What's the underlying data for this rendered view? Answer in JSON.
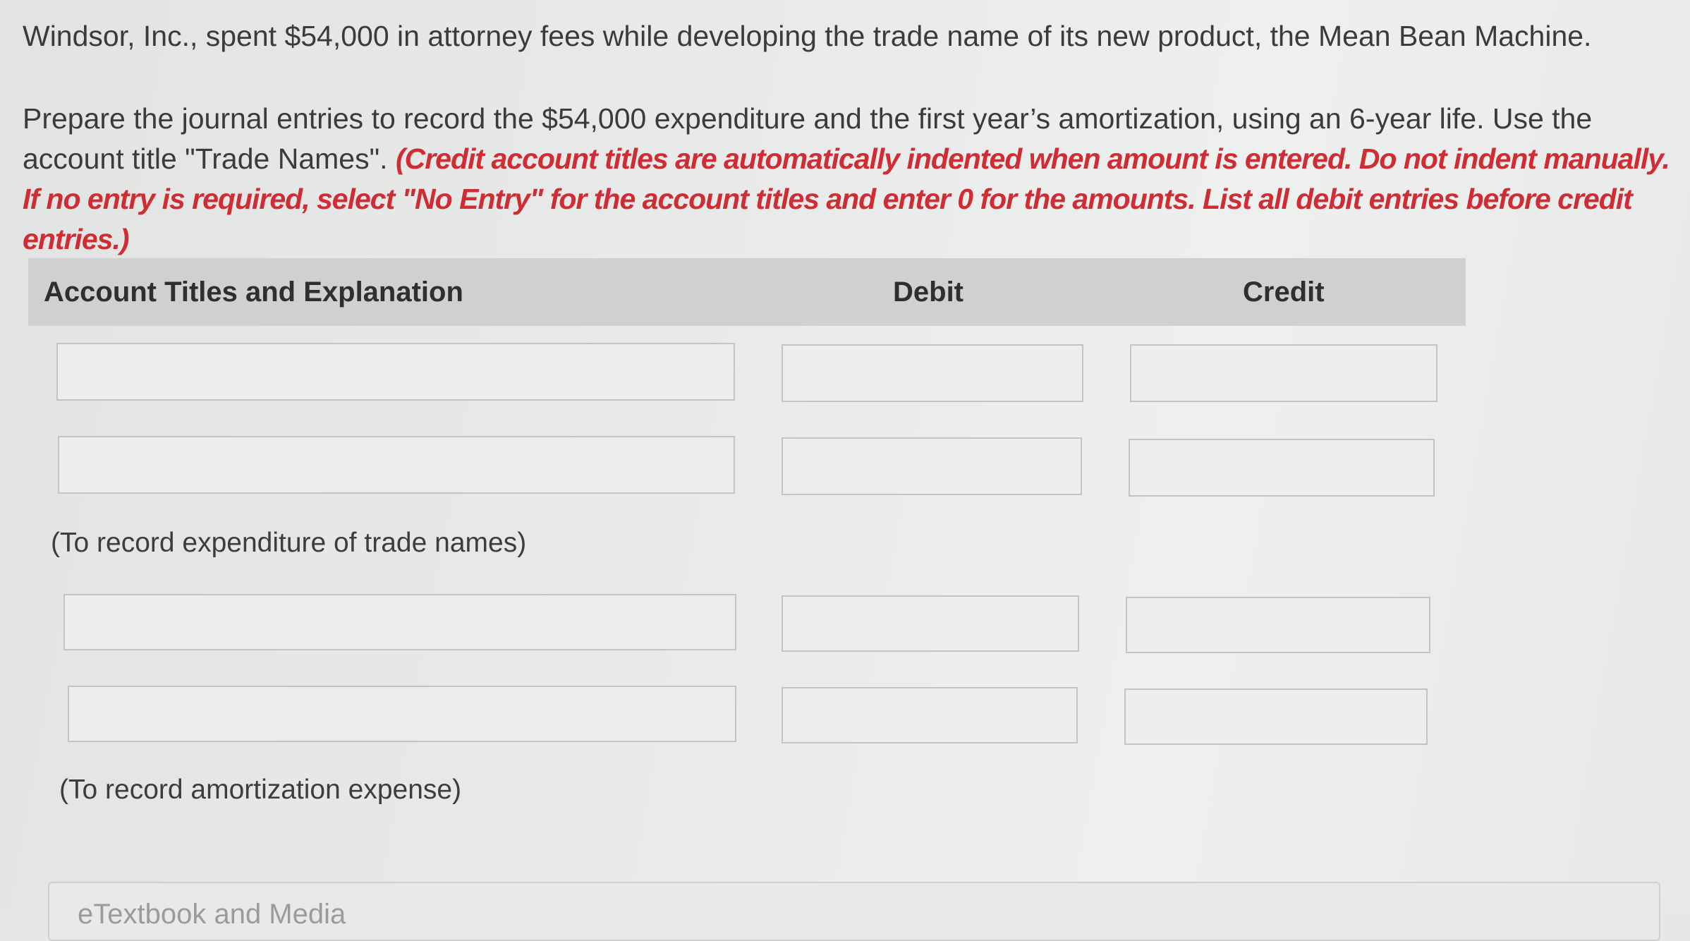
{
  "problem": {
    "intro": "Windsor, Inc., spent $54,000 in attorney fees while developing the trade name of its new product, the Mean Bean Machine.",
    "instructions": "Prepare the journal entries to record the $54,000 expenditure and the first year’s amortization, using an 6-year life. Use the account title \"Trade Names\".",
    "instructions_note": "(Credit account titles are automatically indented when amount is entered. Do not indent manually. If no entry is required, select \"No Entry\" for the account titles and enter 0 for the amounts. List all debit entries before credit entries.)"
  },
  "table": {
    "headers": {
      "account": "Account Titles and Explanation",
      "debit": "Debit",
      "credit": "Credit"
    },
    "entries": [
      {
        "explanation": "(To record expenditure of trade names)",
        "rows": [
          {
            "account": "",
            "debit": "",
            "credit": ""
          },
          {
            "account": "",
            "debit": "",
            "credit": ""
          }
        ]
      },
      {
        "explanation": "(To record amortization expense)",
        "rows": [
          {
            "account": "",
            "debit": "",
            "credit": ""
          },
          {
            "account": "",
            "debit": "",
            "credit": ""
          }
        ]
      }
    ]
  },
  "footer": {
    "link_label": "eTextbook and Media"
  }
}
